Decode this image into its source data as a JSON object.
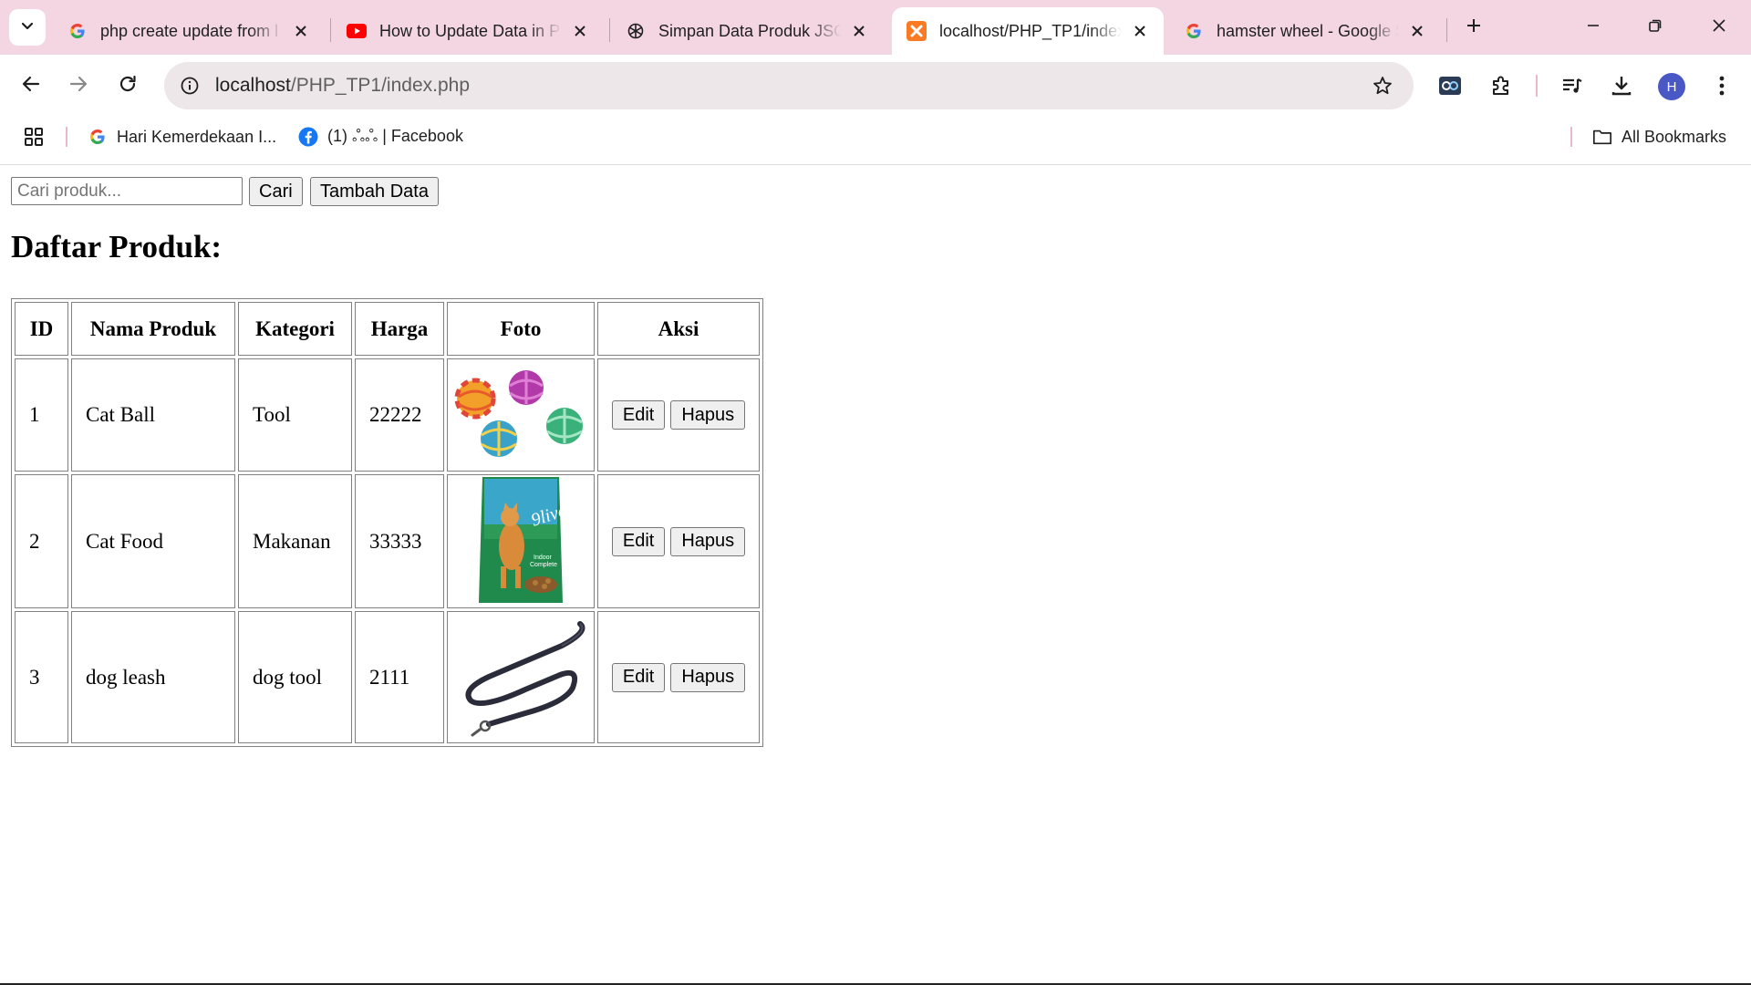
{
  "browser": {
    "tabs": [
      {
        "title": "php create update from l",
        "favicon": "google-g-icon",
        "active": false
      },
      {
        "title": "How to Update Data in P",
        "favicon": "youtube-icon",
        "active": false
      },
      {
        "title": "Simpan Data Produk JSO",
        "favicon": "openai-icon",
        "active": false
      },
      {
        "title": "localhost/PHP_TP1/index",
        "favicon": "xampp-icon",
        "active": true
      },
      {
        "title": "hamster wheel - Google S",
        "favicon": "google-g-icon",
        "active": false
      }
    ],
    "address": {
      "host": "localhost",
      "path": "/PHP_TP1/index.php"
    },
    "avatar_letter": "H",
    "bookmarks": [
      {
        "label": "Hari Kemerdekaan I...",
        "icon": "google-g-icon"
      },
      {
        "label": "(1) ஃஃ | Facebook",
        "icon": "facebook-icon"
      }
    ],
    "all_bookmarks_label": "All Bookmarks"
  },
  "page": {
    "search": {
      "placeholder": "Cari produk...",
      "value": ""
    },
    "search_button": "Cari",
    "add_button": "Tambah Data",
    "heading": "Daftar Produk:",
    "table": {
      "headers": [
        "ID",
        "Nama Produk",
        "Kategori",
        "Harga",
        "Foto",
        "Aksi"
      ],
      "rows": [
        {
          "id": "1",
          "name": "Cat Ball",
          "category": "Tool",
          "price": "22222",
          "photo": "cat-balls-image",
          "edit": "Edit",
          "delete": "Hapus"
        },
        {
          "id": "2",
          "name": "Cat Food",
          "category": "Makanan",
          "price": "33333",
          "photo": "cat-food-bag-image",
          "edit": "Edit",
          "delete": "Hapus"
        },
        {
          "id": "3",
          "name": "dog leash",
          "category": "dog tool",
          "price": "2111",
          "photo": "dog-leash-image",
          "edit": "Edit",
          "delete": "Hapus"
        }
      ]
    }
  },
  "colors": {
    "tabstrip_bg": "#f3d6e2",
    "omnibox_bg": "#ede7ea",
    "avatar_bg": "#4a58c6",
    "button_bg": "#efefef"
  }
}
